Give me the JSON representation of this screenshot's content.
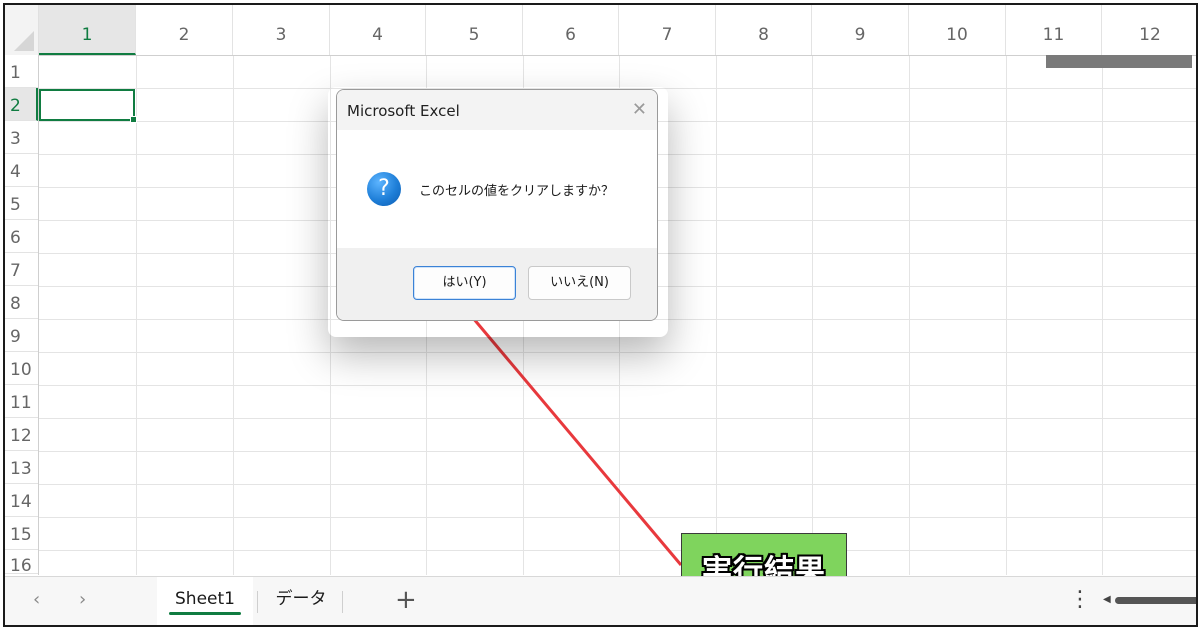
{
  "columns": [
    "1",
    "2",
    "3",
    "4",
    "5",
    "6",
    "7",
    "8",
    "9",
    "10",
    "11",
    "12"
  ],
  "rows": [
    "1",
    "2",
    "3",
    "4",
    "5",
    "6",
    "7",
    "8",
    "9",
    "10",
    "11",
    "12",
    "13",
    "14",
    "15",
    "16"
  ],
  "selection": {
    "column": "1",
    "row": "2"
  },
  "dialog": {
    "title": "Microsoft Excel",
    "close_glyph": "✕",
    "icon_glyph": "?",
    "message": "このセルの値をクリアしますか？",
    "yes_label": "はい(Y)",
    "no_label": "いいえ(N)"
  },
  "annotation": {
    "label": "実行結果",
    "color": "#7fd45d",
    "line_color": "#e8393d"
  },
  "tabs": {
    "prev_glyph": "‹",
    "next_glyph": "›",
    "sheets": [
      "Sheet1",
      "データ"
    ],
    "active": "Sheet1",
    "add_glyph": "+",
    "more_glyph": "⋮"
  },
  "colors": {
    "accent": "#107c41",
    "dialog_button_border": "#3b82d6",
    "icon_blue": "#1f7fd8"
  }
}
